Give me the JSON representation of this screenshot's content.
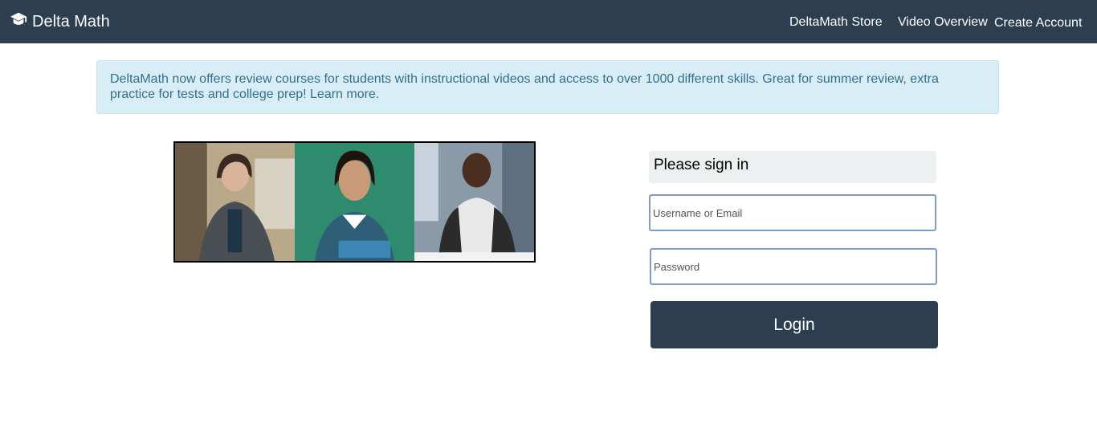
{
  "navbar": {
    "brand": "Delta Math",
    "brand_icon": "graduation-cap-icon",
    "links": {
      "store": "DeltaMath Store",
      "video": "Video Overview",
      "create": "Create Account"
    },
    "background": "#2c3e50"
  },
  "alert": {
    "text": "DeltaMath now offers review courses for students with instructional videos and access to over 1000 different skills. Great for summer review, extra practice for tests and college prep! Learn more.",
    "background": "#d9edf7",
    "text_color": "#31708f"
  },
  "login": {
    "heading": "Please sign in",
    "username_placeholder": "Username or Email",
    "password_placeholder": "Password",
    "button": "Login"
  }
}
